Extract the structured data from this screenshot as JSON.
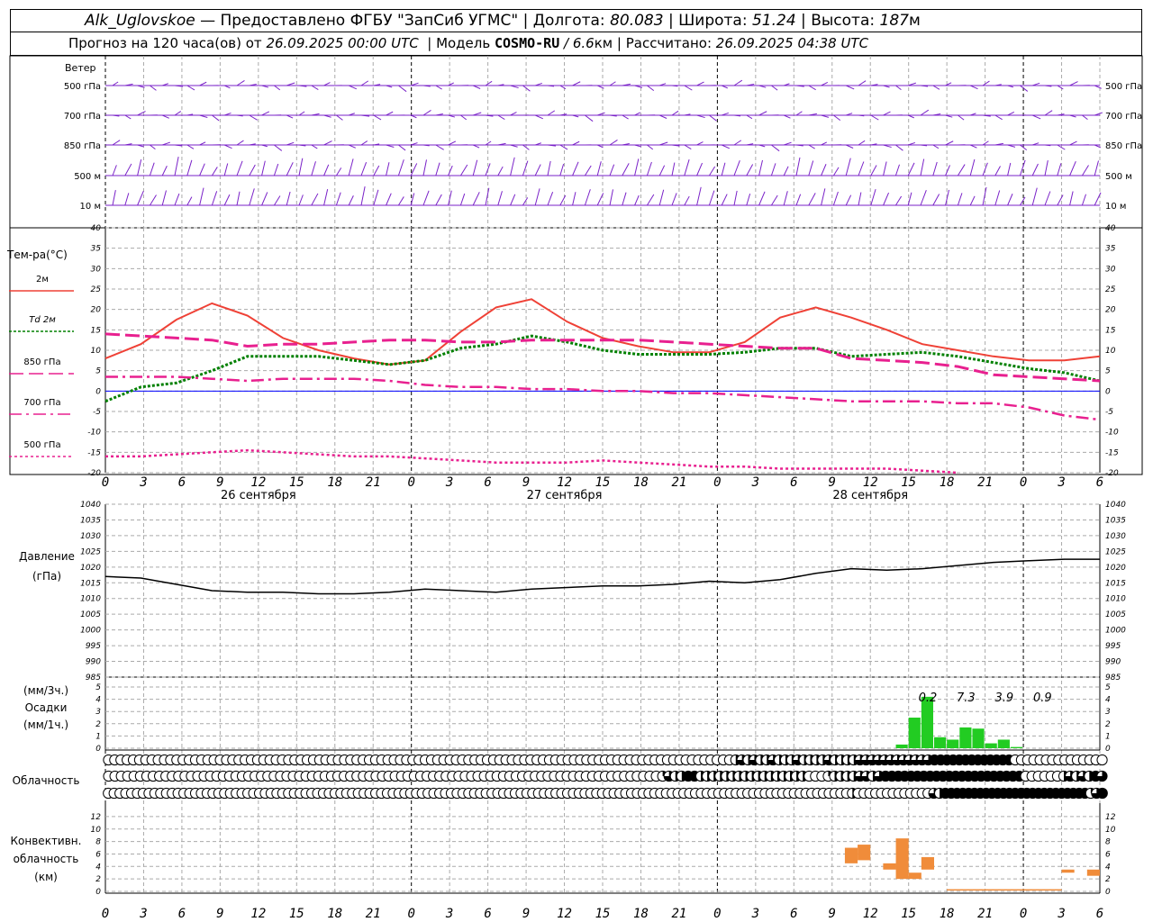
{
  "header": {
    "station": "Alk_Uglovskoe",
    "provider": "— Предоставлено ФГБУ \"ЗапСиб УГМС\"",
    "lon_label": "Долгота:",
    "lon_value": "80.083",
    "lat_label": "Широта:",
    "lat_value": "51.24",
    "alt_label": "Высота:",
    "alt_value": "187",
    "alt_unit": "м",
    "forecast_text": "Прогноз на 120 часа(ов) от",
    "forecast_from": "26.09.2025 00:00 UTC",
    "model_label": "Модель",
    "model_name": "COSMO-RU",
    "model_res": "/ 6.6",
    "model_res_unit": "км",
    "calc_label": "Рассчитано:",
    "calc_time": "26.09.2025 04:38 UTC"
  },
  "colors": {
    "t2m": "#ef4136",
    "td2m": "#008000",
    "t850": "#e8208f",
    "wind": "#7a22c8",
    "precip": "#22cc22",
    "conv": "#f08c3a",
    "pressure": "#000000",
    "zero_line": "#0000ff"
  },
  "time_axis": {
    "ticks": [
      "0",
      "3",
      "6",
      "9",
      "12",
      "15",
      "18",
      "21",
      "0",
      "3",
      "6",
      "9",
      "12",
      "15",
      "18",
      "21",
      "0",
      "3",
      "6",
      "9",
      "12",
      "15",
      "18",
      "21",
      "0",
      "3",
      "6"
    ],
    "days": [
      "26 сентября",
      "27 сентября",
      "28 сентября"
    ]
  },
  "wind_panel": {
    "title": "Ветер",
    "levels": [
      "500 гПа",
      "700 гПа",
      "850 гПа",
      "500 м",
      "10 м"
    ]
  },
  "temp_panel": {
    "title": "Тем-ра(°C)",
    "ticks": [
      "40",
      "35",
      "30",
      "25",
      "20",
      "15",
      "10",
      "5",
      "0",
      "-5",
      "-10",
      "-15",
      "-20"
    ],
    "legend": [
      {
        "label": "2м",
        "style": "solid"
      },
      {
        "label": "Td 2м",
        "style": "dot"
      },
      {
        "label": "850 гПа",
        "style": "dash"
      },
      {
        "label": "700 гПа",
        "style": "dashdot"
      },
      {
        "label": "500 гПа",
        "style": "shortdot"
      }
    ]
  },
  "pressure_panel": {
    "title1": "Давление",
    "title2": "(гПа)",
    "ticks": [
      "1040",
      "1035",
      "1030",
      "1025",
      "1020",
      "1015",
      "1010",
      "1005",
      "1000",
      "995",
      "990",
      "985"
    ]
  },
  "precip_panel": {
    "title1": "(мм/3ч.)",
    "title2": "Осадки",
    "title3": "(мм/1ч.)",
    "ticks": [
      "5",
      "4",
      "3",
      "2",
      "1",
      "0"
    ],
    "totals": [
      "0.2",
      "7.3",
      "3.9",
      "0.9"
    ]
  },
  "cloud_panel": {
    "title": "Облачность"
  },
  "conv_panel": {
    "title1": "Конвективн.",
    "title2": "облачность",
    "title3": "(км)",
    "ticks": [
      "12",
      "10",
      "8",
      "6",
      "4",
      "2",
      "0"
    ]
  },
  "chart_data": {
    "type": "line",
    "x_hours": [
      0,
      3,
      6,
      9,
      12,
      15,
      18,
      21,
      24,
      27,
      30,
      33,
      36,
      39,
      42,
      45,
      48,
      51,
      54,
      57,
      60,
      63,
      66,
      69,
      72,
      75,
      78
    ],
    "temperature": {
      "ylim": [
        -20,
        40
      ],
      "series": [
        {
          "name": "2м",
          "values": [
            8,
            11.5,
            17.5,
            21.5,
            18.5,
            13,
            10,
            8,
            6.5,
            7.5,
            14.5,
            20.5,
            22.5,
            17,
            13,
            11,
            9.5,
            9.5,
            12,
            18,
            20.5,
            18,
            15,
            11.5,
            10,
            8.5,
            7.5,
            7.5,
            8.5
          ]
        },
        {
          "name": "Td 2м",
          "values": [
            -2.5,
            1,
            2,
            5,
            8.5,
            8.5,
            8.5,
            7.5,
            6.5,
            7.5,
            10.5,
            11.5,
            13.5,
            12,
            10,
            9,
            9,
            9,
            9.5,
            10.5,
            10.5,
            8.5,
            9,
            9.5,
            8.5,
            7,
            5.5,
            4.5,
            2.5
          ]
        },
        {
          "name": "850 гПа",
          "values": [
            14,
            13.5,
            13,
            12.5,
            11,
            11.5,
            11.5,
            12,
            12.5,
            12.5,
            12,
            12,
            12.5,
            12.5,
            12.5,
            12.5,
            12,
            11.5,
            11,
            10.5,
            10.5,
            8,
            7.5,
            7,
            6,
            4,
            3.5,
            3,
            2.5
          ]
        },
        {
          "name": "700 гПа",
          "values": [
            3.5,
            3.5,
            3.5,
            3,
            2.5,
            3,
            3,
            3,
            2.5,
            1.5,
            1,
            1,
            0.5,
            0.5,
            0,
            0,
            -0.5,
            -0.5,
            -1,
            -1.5,
            -2,
            -2.5,
            -2.5,
            -2.5,
            -3,
            -3,
            -4,
            -6,
            -7
          ]
        },
        {
          "name": "500 гПа",
          "values": [
            -16,
            -16,
            -15.5,
            -15,
            -14.5,
            -15,
            -15.5,
            -16,
            -16,
            -16.5,
            -17,
            -17.5,
            -17.5,
            -17.5,
            -17,
            -17.5,
            -18,
            -18.5,
            -18.5,
            -19,
            -19,
            -19,
            -19,
            -19.5,
            -20,
            null,
            null,
            null,
            null
          ]
        }
      ]
    },
    "pressure": {
      "ylim": [
        985,
        1040
      ],
      "values": [
        1017,
        1016.5,
        1014.5,
        1012.5,
        1012,
        1012,
        1011.5,
        1011.5,
        1012,
        1013,
        1012.5,
        1012,
        1013,
        1013.5,
        1014,
        1014,
        1014.5,
        1015.5,
        1015,
        1016,
        1018,
        1019.5,
        1019,
        1019.5,
        1020.5,
        1021.5,
        1022,
        1022.5,
        1022.5
      ]
    },
    "precipitation_mm_per_h": {
      "ylim": [
        0,
        5
      ],
      "hours": [
        63,
        64,
        65,
        66,
        67,
        68,
        69,
        70,
        71,
        72
      ],
      "values": [
        0.3,
        2.5,
        4.2,
        0.9,
        0.7,
        1.7,
        1.6,
        0.4,
        0.7,
        0.1
      ],
      "totals_3h": [
        0.2,
        7.3,
        3.9,
        0.9
      ]
    },
    "convective_cloud_km": {
      "ylim": [
        0,
        13
      ],
      "bars": [
        {
          "hour": 59,
          "base": 4.5,
          "top": 7
        },
        {
          "hour": 60,
          "base": 5,
          "top": 7.5
        },
        {
          "hour": 62,
          "base": 3.5,
          "top": 4.5
        },
        {
          "hour": 63,
          "base": 2,
          "top": 8.5
        },
        {
          "hour": 64,
          "base": 2,
          "top": 3
        },
        {
          "hour": 65,
          "base": 3.5,
          "top": 5.5
        },
        {
          "hour": 76,
          "base": 3,
          "top": 3.5
        },
        {
          "hour": 78,
          "base": 2.5,
          "top": 3.5
        }
      ]
    },
    "cloud_cover_rows": [
      {
        "row": "upper",
        "cover": [
          0,
          0,
          0,
          0,
          0,
          0,
          0,
          0,
          0,
          0,
          0,
          0,
          0,
          0,
          0,
          0,
          0,
          0,
          0,
          0,
          0,
          0,
          0,
          0,
          0,
          0,
          0,
          0,
          0,
          0,
          0,
          0,
          0,
          0,
          0,
          0,
          0,
          0,
          0,
          0,
          0,
          0,
          0,
          0,
          0,
          0,
          0,
          0,
          0,
          0,
          0,
          0,
          0,
          0,
          0,
          0,
          0,
          0,
          0,
          0,
          0,
          0,
          0,
          0,
          0,
          0,
          0,
          0,
          0,
          0,
          0,
          0,
          0,
          0,
          0,
          0,
          0,
          0,
          0,
          0,
          0,
          0,
          0,
          0,
          0,
          0,
          0,
          0,
          0,
          0,
          0,
          0,
          0,
          0,
          0,
          0,
          0,
          0,
          0,
          0,
          0,
          2,
          3,
          2,
          3,
          2,
          2,
          3,
          2,
          2,
          2,
          3,
          2,
          2,
          2,
          2,
          3,
          2,
          2,
          2,
          2,
          3,
          3,
          3,
          3,
          3,
          3,
          3,
          3,
          3,
          3,
          3,
          3,
          4,
          4,
          4,
          4,
          4,
          4,
          4,
          4,
          4,
          4,
          4,
          4,
          4,
          0,
          0,
          0,
          0,
          0,
          0,
          0,
          0,
          0,
          0,
          0,
          0,
          0,
          0,
          0
        ]
      },
      {
        "row": "middle",
        "cover": [
          0,
          0,
          0,
          0,
          0,
          0,
          0,
          0,
          0,
          0,
          0,
          0,
          0,
          0,
          0,
          0,
          0,
          0,
          0,
          0,
          0,
          0,
          0,
          0,
          0,
          0,
          0,
          0,
          0,
          0,
          0,
          0,
          0,
          0,
          0,
          0,
          0,
          0,
          0,
          0,
          0,
          0,
          0,
          0,
          0,
          0,
          0,
          0,
          0,
          0,
          0,
          0,
          0,
          0,
          0,
          0,
          0,
          0,
          0,
          0,
          0,
          0,
          0,
          0,
          0,
          0,
          0,
          0,
          0,
          0,
          0,
          0,
          0,
          0,
          0,
          0,
          0,
          0,
          0,
          0,
          0,
          0,
          0,
          0,
          0,
          0,
          0,
          1,
          3,
          2,
          2,
          4,
          4,
          2,
          2,
          2,
          2,
          2,
          2,
          2,
          2,
          2,
          2,
          2,
          2,
          2,
          2,
          2,
          2,
          2,
          0,
          0,
          0,
          1,
          2,
          2,
          2,
          2,
          3,
          3,
          2,
          3,
          4,
          4,
          4,
          4,
          4,
          4,
          4,
          4,
          4,
          4,
          4,
          4,
          4,
          4,
          4,
          4,
          4,
          4,
          4,
          4,
          4,
          4,
          0,
          0,
          0,
          0,
          0,
          0,
          2,
          3,
          2,
          3,
          2,
          4,
          3
        ]
      },
      {
        "row": "lower",
        "cover": [
          0,
          0,
          0,
          0,
          0,
          0,
          0,
          0,
          0,
          0,
          0,
          0,
          0,
          0,
          0,
          0,
          0,
          0,
          0,
          0,
          0,
          0,
          0,
          0,
          0,
          0,
          0,
          0,
          0,
          0,
          0,
          0,
          0,
          0,
          0,
          0,
          0,
          0,
          0,
          0,
          0,
          0,
          0,
          0,
          0,
          0,
          0,
          0,
          0,
          0,
          0,
          0,
          0,
          0,
          0,
          0,
          0,
          0,
          0,
          0,
          0,
          0,
          0,
          0,
          0,
          0,
          0,
          0,
          0,
          0,
          0,
          0,
          0,
          0,
          0,
          0,
          0,
          0,
          0,
          0,
          0,
          0,
          0,
          0,
          0,
          0,
          0,
          0,
          0,
          0,
          0,
          0,
          0,
          0,
          0,
          0,
          0,
          0,
          0,
          0,
          0,
          0,
          0,
          0,
          0,
          0,
          0,
          0,
          0,
          0,
          0,
          0,
          0,
          0,
          0,
          0,
          0,
          0,
          0,
          0,
          0,
          0,
          0,
          0,
          0,
          0,
          0,
          0,
          2,
          0,
          0,
          0,
          0,
          0,
          0,
          0,
          0,
          0,
          0,
          0,
          0,
          0,
          3,
          2,
          4,
          4,
          4,
          4,
          4,
          4,
          4,
          4,
          4,
          4,
          4,
          4,
          4,
          4,
          4,
          4,
          4,
          4,
          4,
          4,
          4,
          4,
          4,
          4,
          4,
          1,
          3,
          4
        ]
      }
    ]
  }
}
